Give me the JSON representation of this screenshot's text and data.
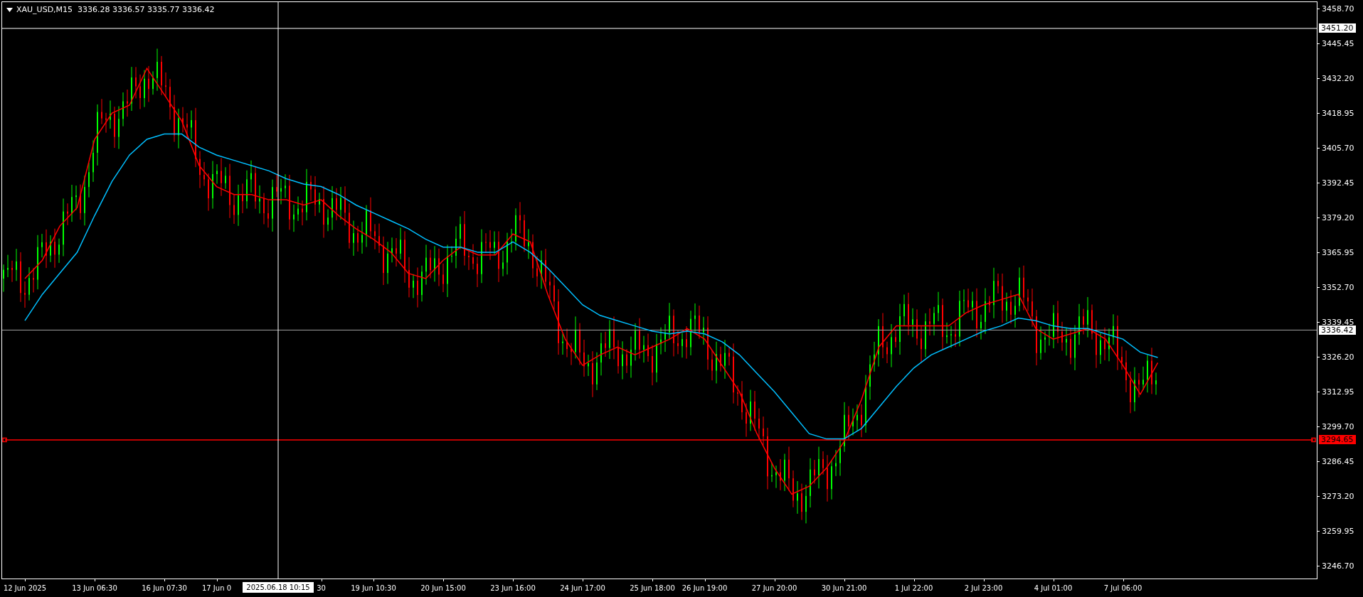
{
  "chart": {
    "chart_data": {
      "type": "line",
      "title": "XAU_USD,M15  3336.28 3336.57 3335.77 3336.42",
      "categories": [
        "12 Jun 2025",
        null,
        null,
        null,
        "13 Jun 06:30",
        null,
        null,
        null,
        "16 Jun 07:30",
        null,
        null,
        "17 Jun 0",
        null,
        null,
        null,
        null,
        null,
        "30",
        null,
        null,
        "19 Jun 10:30",
        null,
        null,
        null,
        "20 Jun 15:00",
        null,
        null,
        null,
        "23 Jun 16:00",
        null,
        null,
        null,
        "24 Jun 17:00",
        null,
        null,
        null,
        "25 Jun 18:00",
        null,
        null,
        "26 Jun 19:00",
        null,
        null,
        null,
        "27 Jun 20:00",
        null,
        null,
        null,
        "30 Jun 21:00",
        null,
        null,
        null,
        "1 Jul 22:00",
        null,
        null,
        null,
        "2 Jul 23:00",
        null,
        null,
        null,
        "4 Jul 01:00",
        null,
        null,
        null,
        "7 Jul 06:00",
        null,
        null
      ],
      "ylim": [
        3241.9,
        3461.2
      ],
      "series": [
        {
          "color": "#ff0000",
          "values": [
            3356,
            3363,
            3376,
            3383,
            3409,
            3419,
            3422,
            3436,
            3426,
            3416,
            3399,
            3391,
            3388,
            3388,
            3386,
            3386,
            3384,
            3386,
            3380,
            3375,
            3371,
            3366,
            3358,
            3356,
            3363,
            3368,
            3365,
            3365,
            3373,
            3370,
            3350,
            3333,
            3323,
            3327,
            3330,
            3327,
            3330,
            3333,
            3337,
            3333,
            3323,
            3313,
            3297,
            3284,
            3274,
            3277,
            3284,
            3294,
            3310,
            3330,
            3338,
            3338,
            3338,
            3338,
            3343,
            3346,
            3348,
            3350,
            3337,
            3333,
            3335,
            3337,
            3333,
            3323,
            3312,
            3324
          ]
        },
        {
          "color": "#00bfff",
          "values": [
            3340,
            3350,
            3358,
            3366,
            3380,
            3393,
            3403,
            3409,
            3411,
            3411,
            3406,
            3403,
            3401,
            3399,
            3397,
            3394,
            3392,
            3391,
            3388,
            3384,
            3381,
            3378,
            3375,
            3371,
            3368,
            3368,
            3366,
            3366,
            3370,
            3366,
            3360,
            3353,
            3346,
            3342,
            3340,
            3338,
            3336,
            3335,
            3336,
            3335,
            3332,
            3327,
            3320,
            3313,
            3305,
            3297,
            3295,
            3295,
            3299,
            3307,
            3315,
            3322,
            3327,
            3330,
            3333,
            3336,
            3338,
            3341,
            3340,
            3338,
            3337,
            3337,
            3335,
            3333,
            3328,
            3326
          ]
        }
      ],
      "yticks": [
        {
          "value": 3458.7,
          "label": "3458.70"
        },
        {
          "value": 3445.45,
          "label": "3445.45"
        },
        {
          "value": 3432.2,
          "label": "3432.20"
        },
        {
          "value": 3418.95,
          "label": "3418.95"
        },
        {
          "value": 3405.7,
          "label": "3405.70"
        },
        {
          "value": 3392.45,
          "label": "3392.45"
        },
        {
          "value": 3379.2,
          "label": "3379.20"
        },
        {
          "value": 3365.95,
          "label": "3365.95"
        },
        {
          "value": 3352.7,
          "label": "3352.70"
        },
        {
          "value": 3339.45,
          "label": "3339.45"
        },
        {
          "value": 3326.2,
          "label": "3326.20"
        },
        {
          "value": 3312.95,
          "label": "3312.95"
        },
        {
          "value": 3299.7,
          "label": "3299.70"
        },
        {
          "value": 3286.45,
          "label": "3286.45"
        },
        {
          "value": 3273.2,
          "label": "3273.20"
        },
        {
          "value": 3259.95,
          "label": "3259.95"
        },
        {
          "value": 3246.7,
          "label": "3246.70"
        }
      ],
      "annotations": [
        "2025.06.18 10:15"
      ],
      "ref_lines": [
        {
          "axis": "y",
          "value": 3451.2,
          "label": "3451.20"
        },
        {
          "axis": "y",
          "value": 3336.42,
          "label": "3336.42"
        },
        {
          "axis": "y",
          "value": 3294.65,
          "label": "3294.65"
        }
      ]
    }
  }
}
